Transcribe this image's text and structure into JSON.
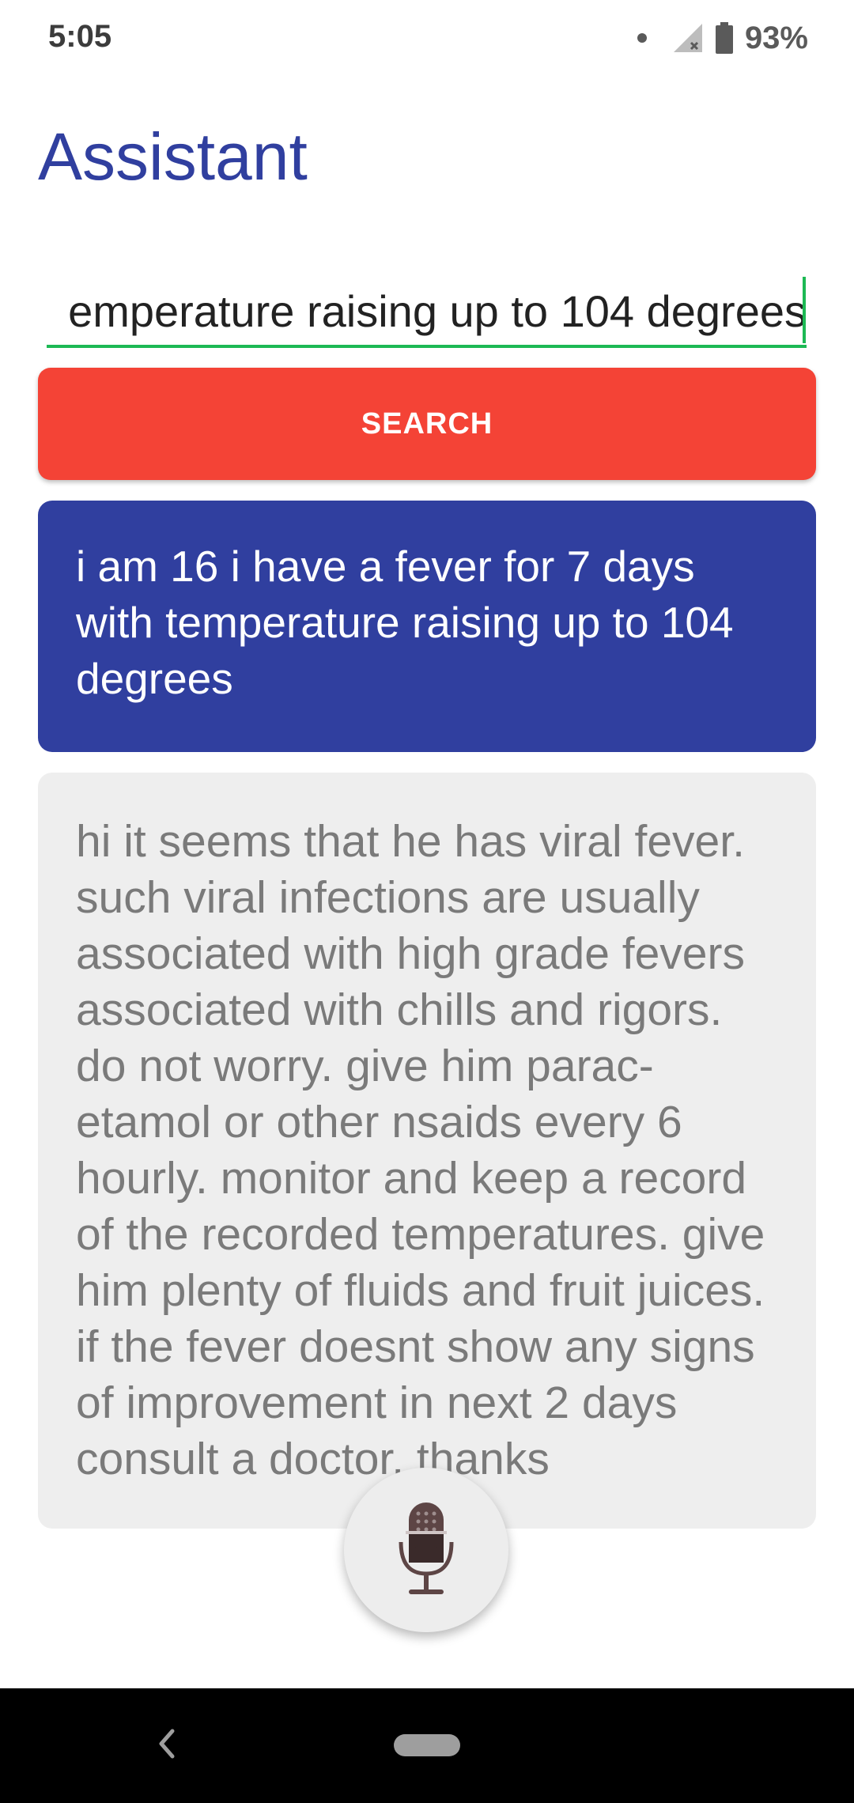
{
  "status_bar": {
    "time": "5:05",
    "battery_percent": "93%",
    "icons": [
      "notification-dot-icon",
      "cellular-signal-icon",
      "battery-icon"
    ]
  },
  "app": {
    "title": "Assistant",
    "title_color": "#303f9f"
  },
  "search": {
    "input_value": "i am 16 i have a fever for 7 days with temperature raising up to 104 degrees",
    "visible_value": "emperature raising up to 104 degrees",
    "button_label": "SEARCH",
    "button_color": "#f44336",
    "underline_color": "#1db954"
  },
  "conversation": {
    "query": "i am 16 i have a fever for 7 days with temperature raising up to 104 degrees",
    "query_bg": "#303f9f",
    "response": "hi it seems that he has viral fever. such viral infections are usually associated with high grade fevers associated with chills and rigors. do not worry. give him parac-etamol or other nsaids every 6 hourly. monitor and keep a record of the recorded temperatures. give him plenty of fluids and fruit juices. if the fever doesnt show any signs of improvement in next 2 days consult a doctor. thanks",
    "response_bg": "#eeeeee"
  },
  "mic": {
    "icon": "microphone-icon"
  },
  "nav_bar": {
    "icons": [
      "back-icon",
      "home-pill-icon"
    ]
  }
}
